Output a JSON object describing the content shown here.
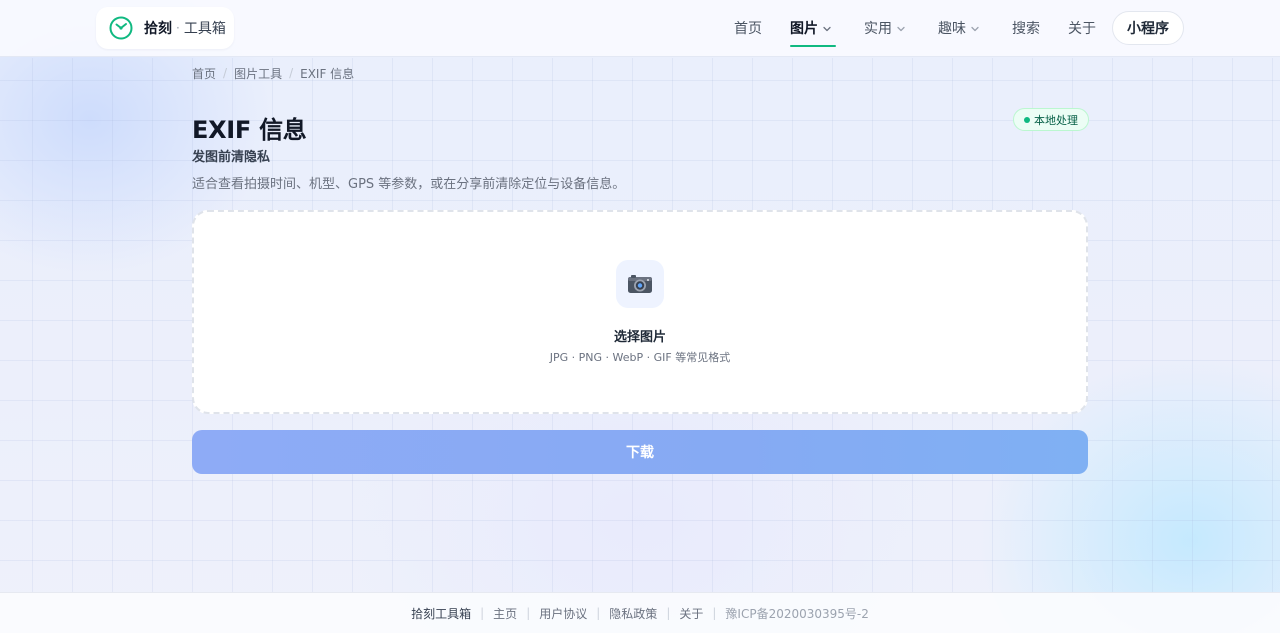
{
  "header": {
    "brand": "拾刻",
    "brand_sep": "·",
    "brand_sub": "工具箱",
    "nav": [
      {
        "label": "首页",
        "has_dropdown": false,
        "active": false
      },
      {
        "label": "图片",
        "has_dropdown": true,
        "active": true
      },
      {
        "label": "实用",
        "has_dropdown": true,
        "active": false
      },
      {
        "label": "趣味",
        "has_dropdown": true,
        "active": false
      },
      {
        "label": "搜索",
        "has_dropdown": false,
        "active": false
      },
      {
        "label": "关于",
        "has_dropdown": false,
        "active": false
      }
    ],
    "mini_program": "小程序"
  },
  "breadcrumb": {
    "items": [
      "首页",
      "图片工具",
      "EXIF 信息"
    ],
    "separator": "/"
  },
  "main": {
    "title": "EXIF 信息",
    "subtitle": "发图前清隐私",
    "description": "适合查看拍摄时间、机型、GPS 等参数，或在分享前清除定位与设备信息。",
    "badge": "本地处理",
    "dropzone": {
      "icon": "camera-icon",
      "title": "选择图片",
      "hint": "JPG · PNG · WebP · GIF 等常见格式"
    },
    "download_label": "下载"
  },
  "footer": {
    "brand": "拾刻工具箱",
    "links": [
      "主页",
      "用户协议",
      "隐私政策",
      "关于"
    ],
    "icp": "豫ICP备2020030395号-2"
  },
  "colors": {
    "accent": "#10b981",
    "button": "#8eabf6",
    "badge_bg": "#ecfdf5"
  }
}
